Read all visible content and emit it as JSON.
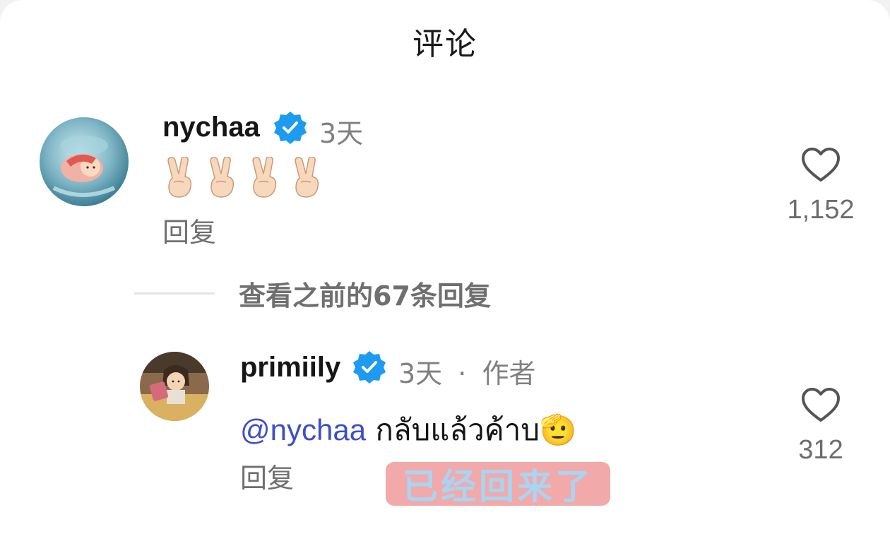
{
  "header": {
    "title": "评论"
  },
  "comments": [
    {
      "username": "nychaa",
      "verified": true,
      "time": "3天",
      "text": "✌🏻✌🏻✌🏻✌🏻",
      "reply_label": "回复",
      "likes": "1,152",
      "avatar_icon": "ponyo-avatar"
    }
  ],
  "view_replies": {
    "label": "查看之前的67条回复"
  },
  "reply_comment": {
    "username": "primiily",
    "verified": true,
    "time": "3天",
    "separator": "·",
    "author_tag": "作者",
    "mention": "@nychaa",
    "text": "กลับแล้วค้าบ🫡",
    "reply_label": "回复",
    "likes": "312",
    "avatar_icon": "chihiro-avatar"
  },
  "sticker": {
    "text": "已经回来了",
    "bg_color": "#f2a9a9",
    "text_color": "#a9d4f2"
  },
  "colors": {
    "verified": "#1d9bf0",
    "mention": "#3c4fc6",
    "muted": "#808080"
  }
}
